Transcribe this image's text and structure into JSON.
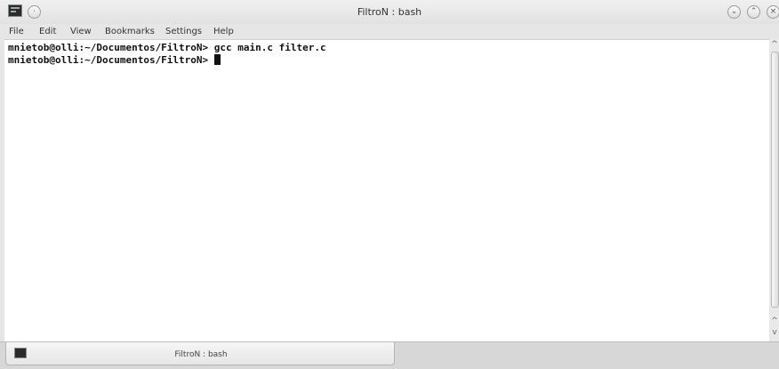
{
  "window": {
    "title": "FiltroN : bash"
  },
  "menu": {
    "items": [
      "File",
      "Edit",
      "View",
      "Bookmarks",
      "Settings",
      "Help"
    ]
  },
  "terminal": {
    "lines": [
      "mnietob@olli:~/Documentos/FiltroN> gcc main.c filter.c",
      "mnietob@olli:~/Documentos/FiltroN> "
    ]
  },
  "tabs": [
    {
      "label": "FiltroN : bash"
    }
  ],
  "colors": {
    "terminal_bg": "#ffffff",
    "terminal_fg": "#111111",
    "chrome": "#e6e6e6"
  }
}
